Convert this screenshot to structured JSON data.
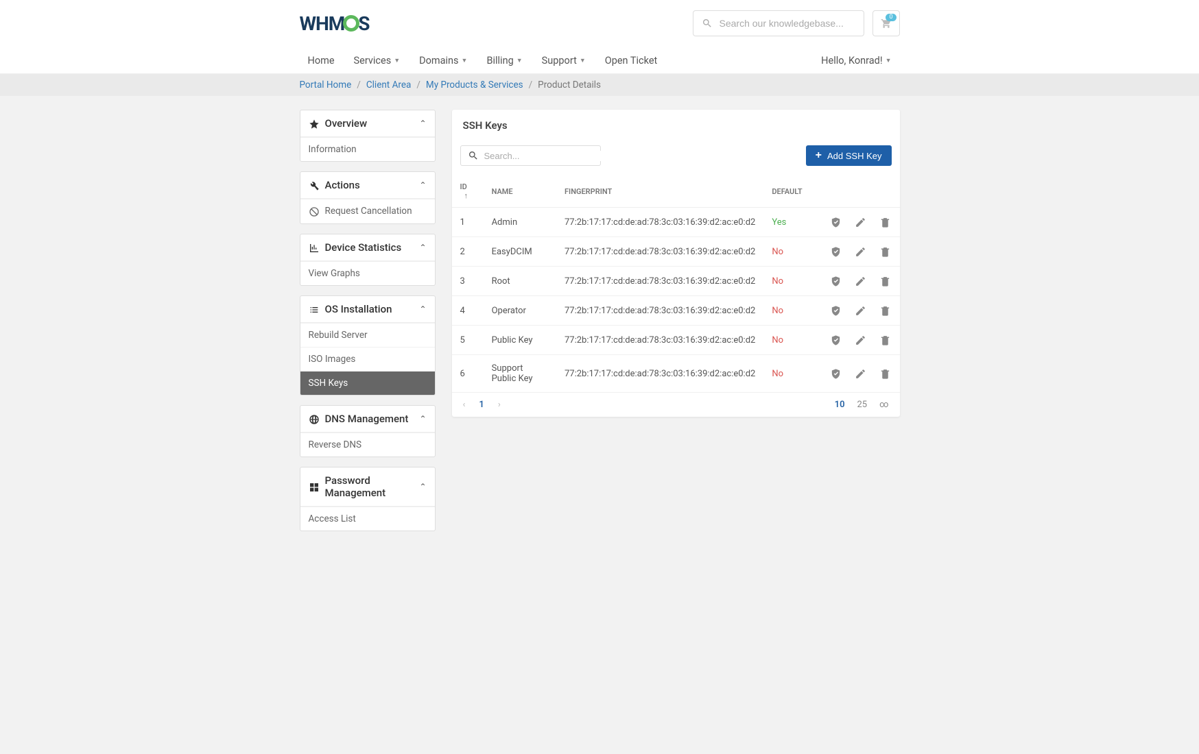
{
  "logo_text_left": "WHM",
  "logo_text_right": "S",
  "search": {
    "placeholder": "Search our knowledgebase..."
  },
  "cart": {
    "count": "0"
  },
  "nav": {
    "items": [
      {
        "label": "Home",
        "dropdown": false
      },
      {
        "label": "Services",
        "dropdown": true
      },
      {
        "label": "Domains",
        "dropdown": true
      },
      {
        "label": "Billing",
        "dropdown": true
      },
      {
        "label": "Support",
        "dropdown": true
      },
      {
        "label": "Open Ticket",
        "dropdown": false
      }
    ],
    "greeting": "Hello, Konrad!"
  },
  "breadcrumbs": [
    {
      "label": "Portal Home",
      "link": true
    },
    {
      "label": "Client Area",
      "link": true
    },
    {
      "label": "My Products & Services",
      "link": true
    },
    {
      "label": "Product Details",
      "link": false
    }
  ],
  "sidebar": {
    "overview": {
      "title": "Overview",
      "items": [
        "Information"
      ]
    },
    "actions": {
      "title": "Actions",
      "items": [
        "Request Cancellation"
      ]
    },
    "stats": {
      "title": "Device Statistics",
      "items": [
        "View Graphs"
      ]
    },
    "os": {
      "title": "OS Installation",
      "items": [
        "Rebuild Server",
        "ISO Images",
        "SSH Keys"
      ],
      "active": "SSH Keys"
    },
    "dns": {
      "title": "DNS Management",
      "items": [
        "Reverse DNS"
      ]
    },
    "pwd": {
      "title": "Password Management",
      "items": [
        "Access List"
      ]
    }
  },
  "page": {
    "title": "SSH Keys",
    "search_placeholder": "Search...",
    "add_button": "Add SSH Key",
    "columns": {
      "id": "ID",
      "name": "NAME",
      "fingerprint": "FINGERPRINT",
      "default": "DEFAULT"
    },
    "rows": [
      {
        "id": "1",
        "name": "Admin",
        "fingerprint": "77:2b:17:17:cd:de:ad:78:3c:03:16:39:d2:ac:e0:d2",
        "default": "Yes"
      },
      {
        "id": "2",
        "name": "EasyDCIM",
        "fingerprint": "77:2b:17:17:cd:de:ad:78:3c:03:16:39:d2:ac:e0:d2",
        "default": "No"
      },
      {
        "id": "3",
        "name": "Root",
        "fingerprint": "77:2b:17:17:cd:de:ad:78:3c:03:16:39:d2:ac:e0:d2",
        "default": "No"
      },
      {
        "id": "4",
        "name": "Operator",
        "fingerprint": "77:2b:17:17:cd:de:ad:78:3c:03:16:39:d2:ac:e0:d2",
        "default": "No"
      },
      {
        "id": "5",
        "name": "Public Key",
        "fingerprint": "77:2b:17:17:cd:de:ad:78:3c:03:16:39:d2:ac:e0:d2",
        "default": "No"
      },
      {
        "id": "6",
        "name": "Support Public Key",
        "fingerprint": "77:2b:17:17:cd:de:ad:78:3c:03:16:39:d2:ac:e0:d2",
        "default": "No"
      }
    ],
    "pagination": {
      "current": "1",
      "sizes": [
        "10",
        "25",
        "∞"
      ],
      "active_size": "10"
    }
  }
}
